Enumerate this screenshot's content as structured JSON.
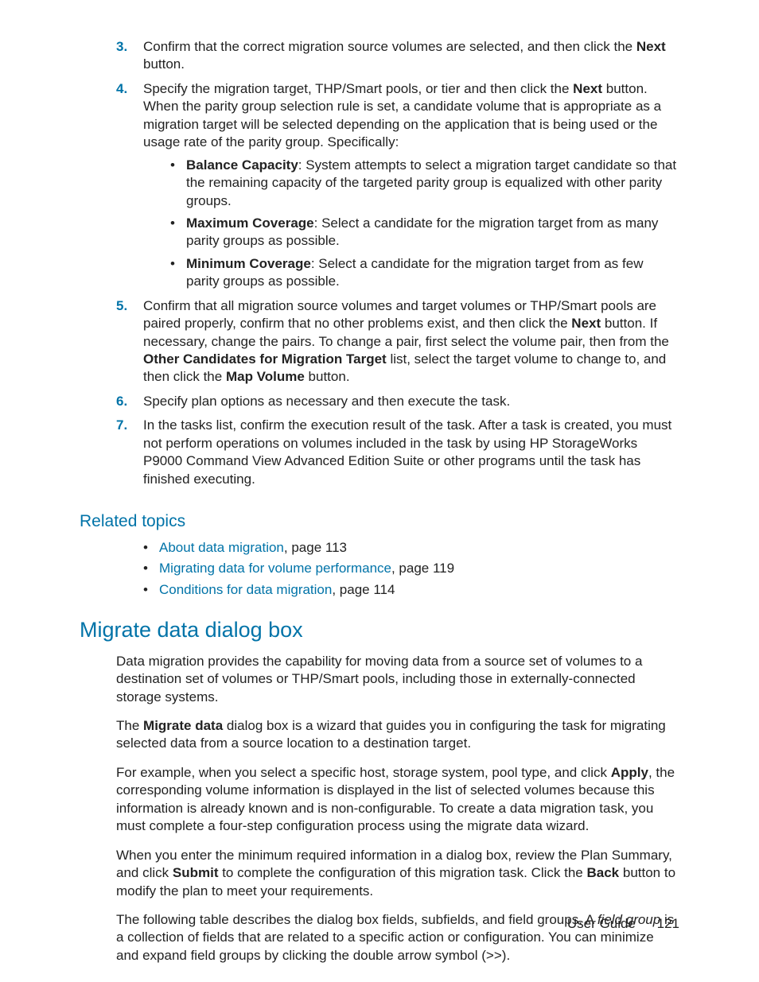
{
  "steps": {
    "s3": {
      "num": "3.",
      "t1": "Confirm that the correct migration source volumes are selected, and then click the ",
      "b1": "Next",
      "t2": " button."
    },
    "s4": {
      "num": "4.",
      "t1": "Specify the migration target, THP/Smart pools, or tier and then click the ",
      "b1": "Next",
      "t2": " button. When the parity group selection rule is set, a candidate volume that is appropriate as a migration target will be selected depending on the application that is being used or the usage rate of the parity group. Specifically:",
      "bullets": {
        "a": {
          "b": "Balance Capacity",
          "t": ": System attempts to select a migration target candidate so that the remaining capacity of the targeted parity group is equalized with other parity groups."
        },
        "b": {
          "b": "Maximum Coverage",
          "t": ": Select a candidate for the migration target from as many parity groups as possible."
        },
        "c": {
          "b": "Minimum Coverage",
          "t": ": Select a candidate for the migration target from as few parity groups as possible."
        }
      }
    },
    "s5": {
      "num": "5.",
      "t1": "Confirm that all migration source volumes and target volumes or THP/Smart pools are paired properly, confirm that no other problems exist, and then click the ",
      "b1": "Next",
      "t2": " button. If necessary, change the pairs. To change a pair, first select the volume pair, then from the ",
      "b2": "Other Candidates for Migration Target",
      "t3": " list, select the target volume to change to, and then click the ",
      "b3": "Map Volume",
      "t4": " button."
    },
    "s6": {
      "num": "6.",
      "t1": "Specify plan options as necessary and then execute the task."
    },
    "s7": {
      "num": "7.",
      "t1": "In the tasks list, confirm the execution result of the task. After a task is created, you must not perform operations on volumes included in the task by using HP StorageWorks P9000 Command View Advanced Edition Suite or other programs until the task has finished executing."
    }
  },
  "related": {
    "heading": "Related topics",
    "items": {
      "a": {
        "link": "About data migration",
        "suffix": ", page 113"
      },
      "b": {
        "link": "Migrating data for volume performance",
        "suffix": ", page 119"
      },
      "c": {
        "link": "Conditions for data migration",
        "suffix": ", page 114"
      }
    }
  },
  "section": {
    "heading": "Migrate data dialog box",
    "p1": "Data migration provides the capability for moving data from a source set of volumes to a destination set of volumes or THP/Smart pools, including those in externally-connected storage systems.",
    "p2": {
      "t1": "The ",
      "b1": "Migrate data",
      "t2": " dialog box is a wizard that guides you in configuring the task for migrating selected data from a source location to a destination target."
    },
    "p3": {
      "t1": "For example, when you select a specific host, storage system, pool type, and click ",
      "b1": "Apply",
      "t2": ", the corresponding volume information is displayed in the list of selected volumes because this information is already known and is non-configurable. To create a data migration task, you must complete a four-step configuration process using the migrate data wizard."
    },
    "p4": {
      "t1": "When you enter the minimum required information in a dialog box, review the Plan Summary, and click ",
      "b1": "Submit",
      "t2": " to complete the configuration of this migration task. Click the ",
      "b2": "Back",
      "t3": " button to modify the plan to meet your requirements."
    },
    "p5": {
      "t1": "The following table describes the dialog box fields, subfields, and field groups. A ",
      "i1": "field group",
      "t2": " is a collection of fields that are related to a specific action or configuration. You can minimize and expand field groups by clicking the double arrow symbol (>>)."
    }
  },
  "footer": {
    "label": "User Guide",
    "page": "121"
  }
}
